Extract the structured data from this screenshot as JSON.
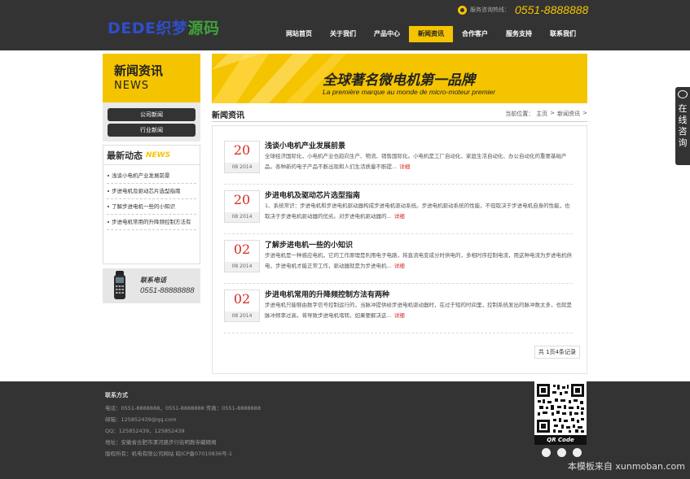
{
  "header": {
    "logo_part1": "DEDE织梦",
    "logo_part2": "源码",
    "hotline_label": "服务咨询热线：",
    "hotline_number": "0551-8888888"
  },
  "nav": {
    "items": [
      {
        "label": "网站首页",
        "active": false
      },
      {
        "label": "关于我们",
        "active": false
      },
      {
        "label": "产品中心",
        "active": false
      },
      {
        "label": "新闻资讯",
        "active": true
      },
      {
        "label": "合作客户",
        "active": false
      },
      {
        "label": "服务支持",
        "active": false
      },
      {
        "label": "联系我们",
        "active": false
      }
    ]
  },
  "sidebar": {
    "title_cn": "新闻资讯",
    "title_en": "NEWS",
    "categories": [
      "公司新闻",
      "行业新闻"
    ],
    "latest_title_cn": "最新动态",
    "latest_title_en": "NEWS",
    "latest_items": [
      "浅谈小电机产业发展前景",
      "步进电机及驱动芯片选型指南",
      "了解步进电机一些的小知识",
      "步进电机常用的升降频控制方法有"
    ],
    "contact_label": "联系电话",
    "contact_number": "0551-88888888"
  },
  "banner": {
    "title": "全球著名微电机第一品牌",
    "subtitle": "La première marque au monde de micro-moteur premier"
  },
  "main": {
    "section_title": "新闻资讯",
    "breadcrumb": [
      "当前位置：",
      "主页",
      ">",
      "新闻资讯",
      ">"
    ],
    "articles": [
      {
        "day": "20",
        "ym": "08 2014",
        "title": "浅谈小电机产业发展前景",
        "desc": "全球经济国际化，小电机产业也趋向生产、物流、销售国际化。小电机是工厂自动化、家庭生活自动化、办公自动化的重要基础产品。各种新的电子产品不断出现和人们生活质量不断提...",
        "more": "详细"
      },
      {
        "day": "20",
        "ym": "08 2014",
        "title": "步进电机及驱动芯片选型指南",
        "desc": "1、系统常识：步进电机和步进电机驱动器构成步进电机驱动系统。步进电机驱动系统的性能，不但取决于步进电机自身的性能，也取决于步进电机驱动器的优劣。对步进电机驱动器的...",
        "more": "详细"
      },
      {
        "day": "02",
        "ym": "08 2014",
        "title": "了解步进电机一些的小知识",
        "desc": "步进电机是一种感应电机，它的工作原理是利用电子电路，将直流电变成分时供电的，多相时序控制电流，用这种电流为步进电机供电，步进电机才能正常工作，驱动器就是为步进电机...",
        "more": "详细"
      },
      {
        "day": "02",
        "ym": "08 2014",
        "title": "步进电机常用的升降频控制方法有两种",
        "desc": "步进电机只能够由数字信号控制运行的，当脉冲提供给步进电机驱动器时，在过于短的时间里，控制系统发出的脉冲数太多，也就是脉冲频率过高，将导致步进电机堵转。如果要解决这...",
        "more": "详细"
      }
    ],
    "pager": "共 1页4条记录"
  },
  "float_service": {
    "text": "在线咨询"
  },
  "footer": {
    "title": "联系方式",
    "lines": [
      "电话：0551-8888888，0551-8888888  传真：0551-8888888",
      "邮箱：125852439@qq.com",
      "QQ：125852439，125852439",
      "地址：安徽省合肥市漯河路步行街明教寺藏精阁",
      "版权所有：机电有限公司网站  皖ICP备07010836号-1"
    ],
    "qr_label": "QR Code",
    "watermark": "本模板来自 xunmoban.com"
  },
  "colors": {
    "accent": "#f5c400",
    "dark": "#333333",
    "date_red": "#d62b1e"
  }
}
